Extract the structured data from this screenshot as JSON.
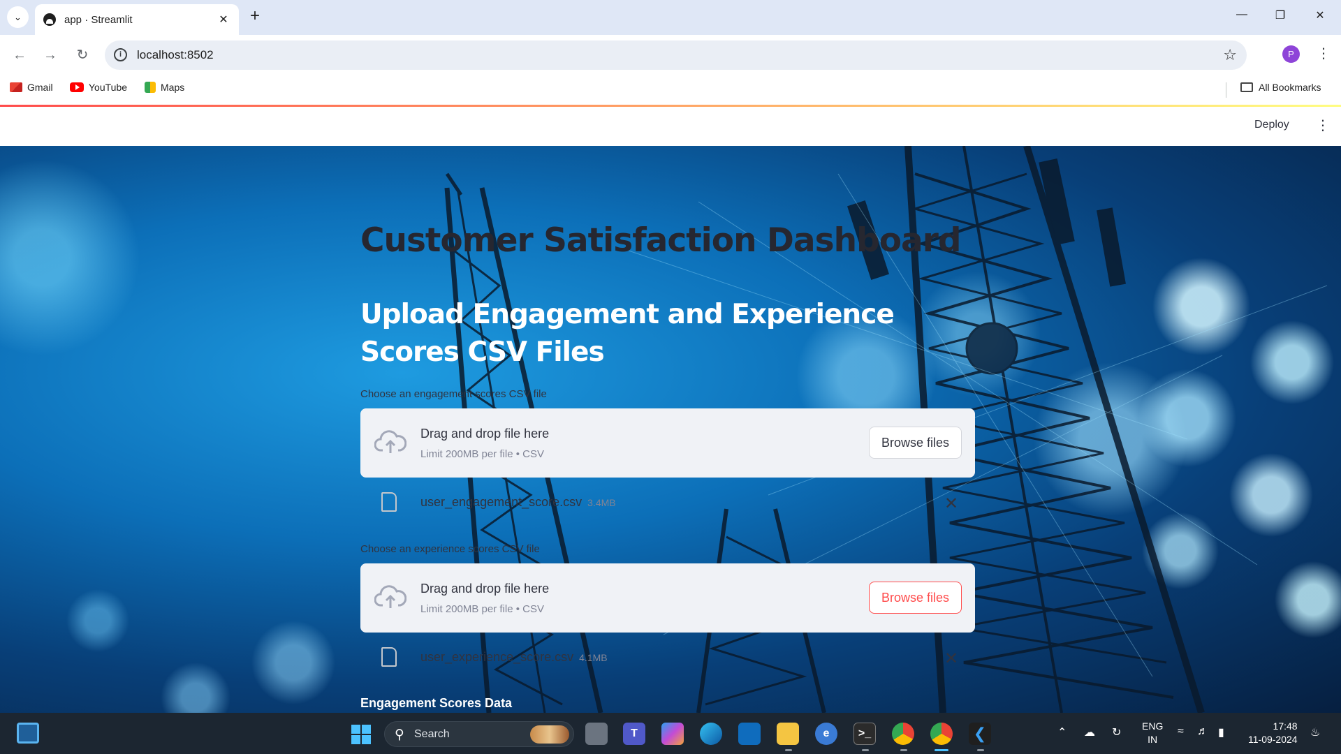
{
  "browser": {
    "tab_title": "app · Streamlit",
    "url": "localhost:8502",
    "profile_initial": "P",
    "bookmarks": [
      "Gmail",
      "YouTube",
      "Maps"
    ],
    "all_bookmarks": "All Bookmarks"
  },
  "streamlit": {
    "deploy_label": "Deploy"
  },
  "app": {
    "title": "Customer Satisfaction Dashboard",
    "subtitle": "Upload Engagement and Experience Scores CSV Files",
    "uploaders": [
      {
        "label": "Choose an engagement scores CSV file",
        "drop_text": "Drag and drop file here",
        "limit_text": "Limit 200MB per file • CSV",
        "button_label": "Browse files",
        "file_name": "user_engagement_score.csv",
        "file_size": "3.4MB"
      },
      {
        "label": "Choose an experience scores CSV file",
        "drop_text": "Drag and drop file here",
        "limit_text": "Limit 200MB per file • CSV",
        "button_label": "Browse files",
        "file_name": "user_experience_score.csv",
        "file_size": "4.1MB"
      }
    ],
    "section_heading": "Engagement Scores Data"
  },
  "taskbar": {
    "search_placeholder": "Search",
    "language": "ENG",
    "region": "IN",
    "time": "17:48",
    "date": "11-09-2024"
  },
  "colors": {
    "streamlit_primary": "#ff4b4b",
    "title_text": "#262730",
    "dropzone_bg": "#f0f2f6"
  }
}
